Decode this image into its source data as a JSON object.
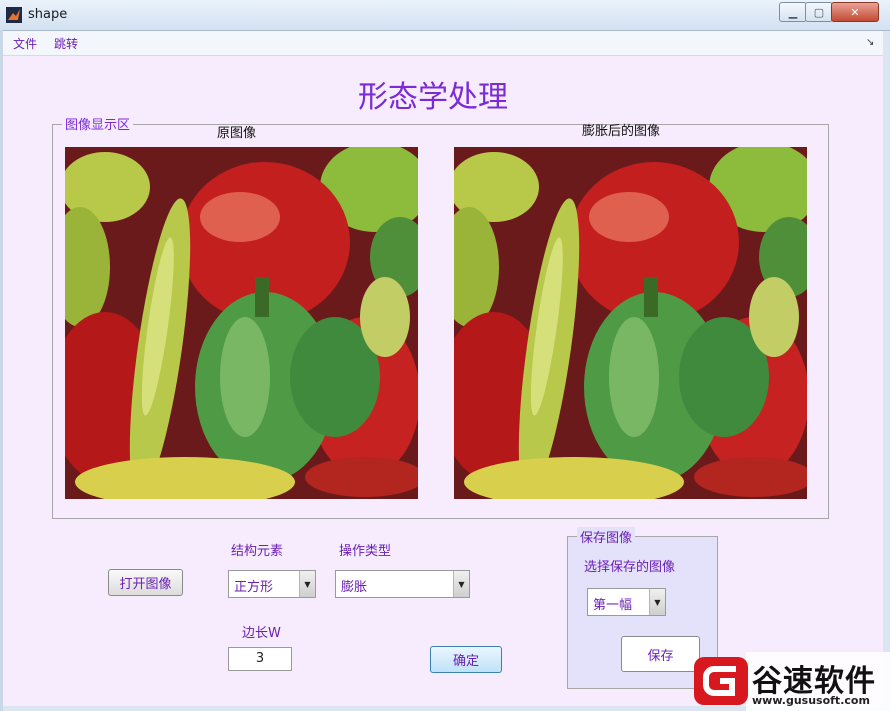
{
  "window": {
    "title": "shape"
  },
  "menu": {
    "items": [
      "文件",
      "跳转"
    ]
  },
  "main_title": "形态学处理",
  "display_panel": {
    "title": "图像显示区",
    "original_label": "原图像",
    "processed_label": "膨胀后的图像"
  },
  "controls": {
    "open_button": "打开图像",
    "struct_label": "结构元素",
    "struct_value": "正方形",
    "op_label": "操作类型",
    "op_value": "膨胀",
    "side_label": "边长W",
    "side_value": "3",
    "confirm_button": "确定"
  },
  "save_panel": {
    "title": "保存图像",
    "select_label": "选择保存的图像",
    "select_value": "第一幅",
    "save_button": "保存"
  },
  "watermark": {
    "brand": "谷速软件",
    "url": "www.gususoft.com"
  }
}
